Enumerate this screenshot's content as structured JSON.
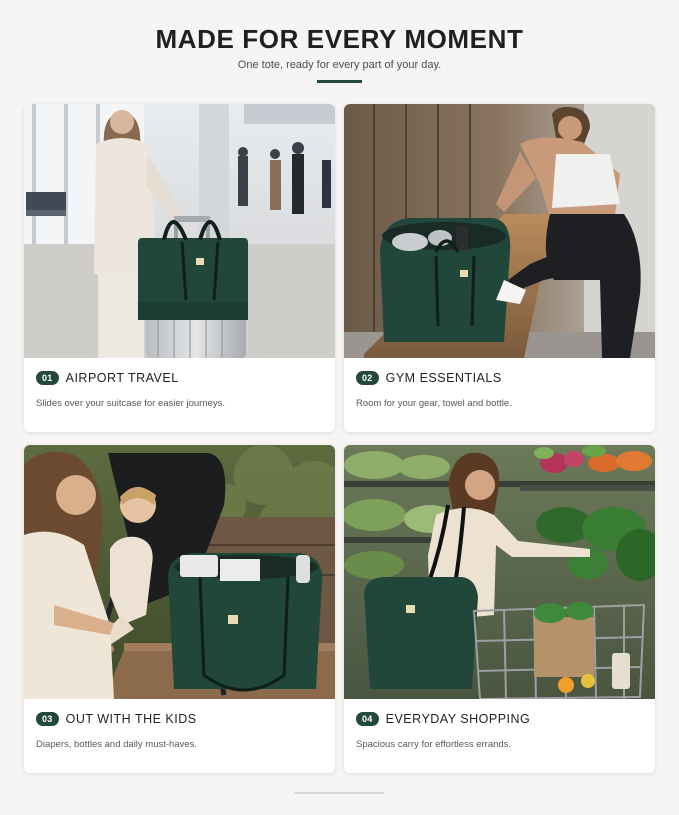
{
  "header": {
    "title": "MADE FOR EVERY MOMENT",
    "subtitle": "One tote, ready for every part of your day."
  },
  "cards": [
    {
      "number": "01",
      "title": "AIRPORT TRAVEL",
      "description": "Slides over your suitcase for easier journeys.",
      "scene": "airport terminal, woman with green tote on silver suitcase"
    },
    {
      "number": "02",
      "title": "GYM ESSENTIALS",
      "description": "Room for your gear, towel and bottle.",
      "scene": "gym locker room, open green tote on wooden bench"
    },
    {
      "number": "03",
      "title": "OUT WITH THE KIDS",
      "description": "Diapers, bottles and daily must-haves.",
      "scene": "park bench, mother with toddler in stroller, green tote"
    },
    {
      "number": "04",
      "title": "EVERYDAY SHOPPING",
      "description": "Spacious carry for effortless errands.",
      "scene": "grocery produce aisle, woman with green tote and cart"
    }
  ],
  "colors": {
    "accent": "#24483a",
    "tote_green": "#21473a",
    "background": "#f6f5f3",
    "card": "#ffffff"
  }
}
